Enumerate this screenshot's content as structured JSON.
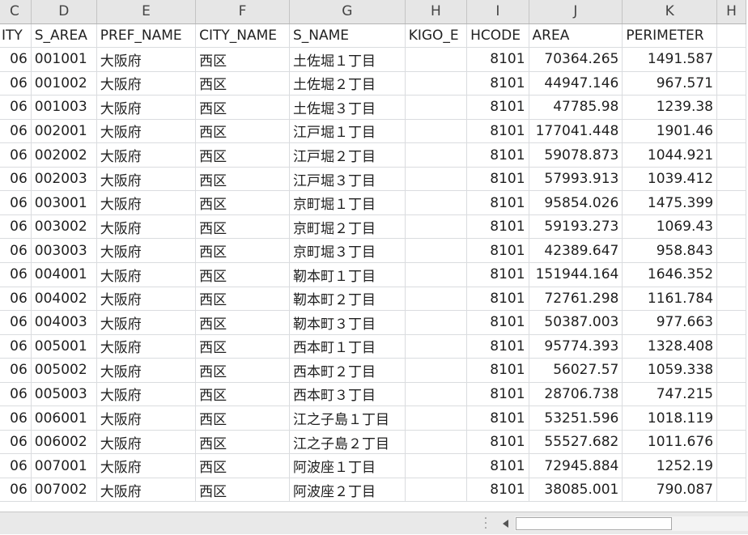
{
  "sheet": {
    "column_letters": [
      "C",
      "D",
      "E",
      "F",
      "G",
      "H",
      "I",
      "J",
      "K",
      "H"
    ],
    "field_names": [
      "ITY",
      "S_AREA",
      "PREF_NAME",
      "CITY_NAME",
      "S_NAME",
      "KIGO_E",
      "HCODE",
      "AREA",
      "PERIMETER",
      ""
    ],
    "rows": [
      [
        "06",
        "001001",
        "大阪府",
        "西区",
        "土佐堀１丁目",
        "",
        "8101",
        "70364.265",
        "1491.587",
        ""
      ],
      [
        "06",
        "001002",
        "大阪府",
        "西区",
        "土佐堀２丁目",
        "",
        "8101",
        "44947.146",
        "967.571",
        ""
      ],
      [
        "06",
        "001003",
        "大阪府",
        "西区",
        "土佐堀３丁目",
        "",
        "8101",
        "47785.98",
        "1239.38",
        ""
      ],
      [
        "06",
        "002001",
        "大阪府",
        "西区",
        "江戸堀１丁目",
        "",
        "8101",
        "177041.448",
        "1901.46",
        ""
      ],
      [
        "06",
        "002002",
        "大阪府",
        "西区",
        "江戸堀２丁目",
        "",
        "8101",
        "59078.873",
        "1044.921",
        ""
      ],
      [
        "06",
        "002003",
        "大阪府",
        "西区",
        "江戸堀３丁目",
        "",
        "8101",
        "57993.913",
        "1039.412",
        ""
      ],
      [
        "06",
        "003001",
        "大阪府",
        "西区",
        "京町堀１丁目",
        "",
        "8101",
        "95854.026",
        "1475.399",
        ""
      ],
      [
        "06",
        "003002",
        "大阪府",
        "西区",
        "京町堀２丁目",
        "",
        "8101",
        "59193.273",
        "1069.43",
        ""
      ],
      [
        "06",
        "003003",
        "大阪府",
        "西区",
        "京町堀３丁目",
        "",
        "8101",
        "42389.647",
        "958.843",
        ""
      ],
      [
        "06",
        "004001",
        "大阪府",
        "西区",
        "靭本町１丁目",
        "",
        "8101",
        "151944.164",
        "1646.352",
        ""
      ],
      [
        "06",
        "004002",
        "大阪府",
        "西区",
        "靭本町２丁目",
        "",
        "8101",
        "72761.298",
        "1161.784",
        ""
      ],
      [
        "06",
        "004003",
        "大阪府",
        "西区",
        "靭本町３丁目",
        "",
        "8101",
        "50387.003",
        "977.663",
        ""
      ],
      [
        "06",
        "005001",
        "大阪府",
        "西区",
        "西本町１丁目",
        "",
        "8101",
        "95774.393",
        "1328.408",
        ""
      ],
      [
        "06",
        "005002",
        "大阪府",
        "西区",
        "西本町２丁目",
        "",
        "8101",
        "56027.57",
        "1059.338",
        ""
      ],
      [
        "06",
        "005003",
        "大阪府",
        "西区",
        "西本町３丁目",
        "",
        "8101",
        "28706.738",
        "747.215",
        ""
      ],
      [
        "06",
        "006001",
        "大阪府",
        "西区",
        "江之子島１丁目",
        "",
        "8101",
        "53251.596",
        "1018.119",
        ""
      ],
      [
        "06",
        "006002",
        "大阪府",
        "西区",
        "江之子島２丁目",
        "",
        "8101",
        "55527.682",
        "1011.676",
        ""
      ],
      [
        "06",
        "007001",
        "大阪府",
        "西区",
        "阿波座１丁目",
        "",
        "8101",
        "72945.884",
        "1252.19",
        ""
      ],
      [
        "06",
        "007002",
        "大阪府",
        "西区",
        "阿波座２丁目",
        "",
        "8101",
        "38085.001",
        "790.087",
        ""
      ]
    ]
  },
  "scrollbar": {
    "horizontal_thumb_fraction": 0.67
  },
  "icons": {
    "scroll_left": "triangle-left-icon",
    "split_handle": "vertical-dots-icon"
  },
  "colors": {
    "header_bg": "#e6e6e6",
    "gridline": "#dadcdf",
    "text": "#1f1f1f",
    "bottom_bar": "#e9e9e9"
  }
}
